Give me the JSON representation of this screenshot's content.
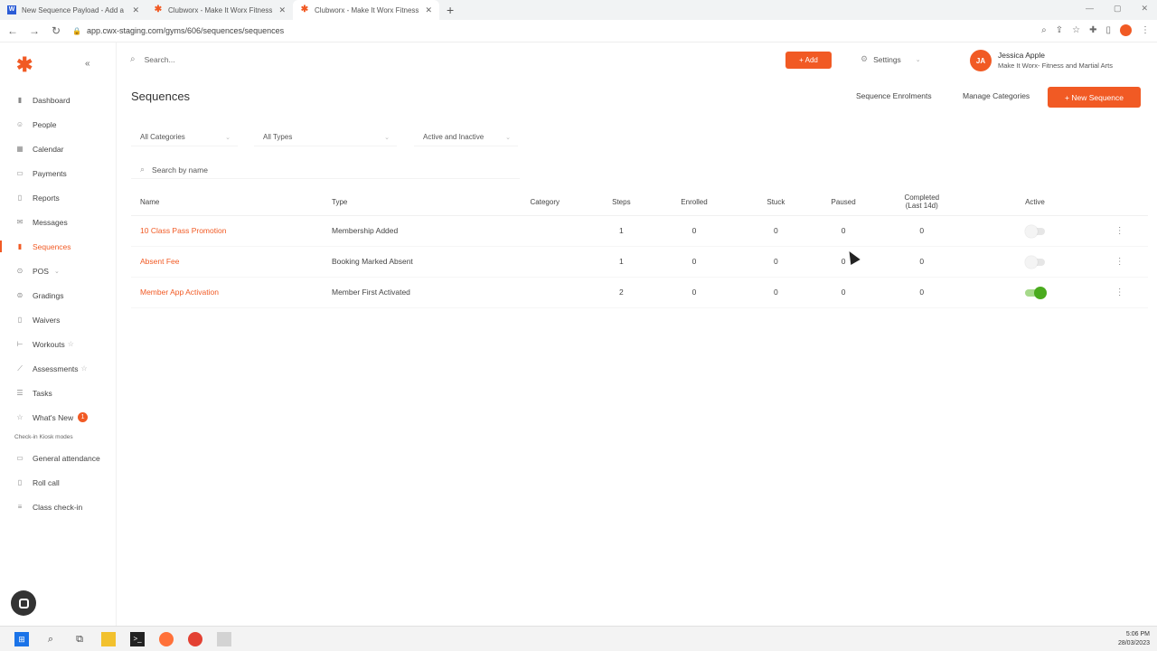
{
  "browser": {
    "tabs": [
      {
        "title": "New Sequence Payload - Add a",
        "active": false
      },
      {
        "title": "Clubworx - Make It Worx Fitness",
        "active": false
      },
      {
        "title": "Clubworx - Make It Worx Fitness",
        "active": true
      }
    ],
    "url": "app.cwx-staging.com/gyms/606/sequences/sequences"
  },
  "sidebar": {
    "items": [
      {
        "label": "Dashboard",
        "icon": "bar-chart-icon"
      },
      {
        "label": "People",
        "icon": "person-icon"
      },
      {
        "label": "Calendar",
        "icon": "calendar-icon"
      },
      {
        "label": "Payments",
        "icon": "card-icon"
      },
      {
        "label": "Reports",
        "icon": "document-icon"
      },
      {
        "label": "Messages",
        "icon": "message-icon"
      },
      {
        "label": "Sequences",
        "icon": "sequence-icon",
        "active": true
      },
      {
        "label": "POS",
        "icon": "cart-icon"
      },
      {
        "label": "Gradings",
        "icon": "belt-icon"
      },
      {
        "label": "Waivers",
        "icon": "document-icon"
      },
      {
        "label": "Workouts",
        "icon": "dumbbell-icon"
      },
      {
        "label": "Assessments",
        "icon": "chart-line-icon"
      },
      {
        "label": "Tasks",
        "icon": "list-icon"
      },
      {
        "label": "What's New",
        "icon": "star-icon",
        "badge": "1"
      }
    ],
    "section_label": "Check-in Kiosk modes",
    "kiosk_items": [
      {
        "label": "General attendance",
        "icon": "document-icon"
      },
      {
        "label": "Roll call",
        "icon": "phone-icon"
      },
      {
        "label": "Class check-in",
        "icon": "list-icon"
      }
    ]
  },
  "header": {
    "search_placeholder": "Search...",
    "add_label": "+ Add",
    "settings_label": "Settings",
    "user_initials": "JA",
    "user_name": "Jessica Apple",
    "user_org": "Make It Worx- Fitness and Martial Arts"
  },
  "page": {
    "title": "Sequences",
    "enrolments_label": "Sequence Enrolments",
    "manage_categories_label": "Manage Categories",
    "new_sequence_label": "+ New Sequence",
    "filters": {
      "category": "All Categories",
      "type": "All Types",
      "status": "Active and Inactive"
    },
    "name_search_placeholder": "Search by name"
  },
  "table": {
    "headers": {
      "name": "Name",
      "type": "Type",
      "category": "Category",
      "steps": "Steps",
      "enrolled": "Enrolled",
      "stuck": "Stuck",
      "paused": "Paused",
      "completed_line1": "Completed",
      "completed_line2": "(Last 14d)",
      "active": "Active"
    },
    "rows": [
      {
        "name": "10 Class Pass Promotion",
        "type": "Membership Added",
        "category": "",
        "steps": "1",
        "enrolled": "0",
        "stuck": "0",
        "paused": "0",
        "completed": "0",
        "active": false
      },
      {
        "name": "Absent Fee",
        "type": "Booking Marked Absent",
        "category": "",
        "steps": "1",
        "enrolled": "0",
        "stuck": "0",
        "paused": "0",
        "completed": "0",
        "active": false
      },
      {
        "name": "Member App Activation",
        "type": "Member First Activated",
        "category": "",
        "steps": "2",
        "enrolled": "0",
        "stuck": "0",
        "paused": "0",
        "completed": "0",
        "active": true
      }
    ]
  },
  "taskbar": {
    "time": "5:06 PM",
    "date": "28/03/2023"
  },
  "colors": {
    "brand": "#f15a24",
    "toggle_on": "#4aab1e"
  }
}
